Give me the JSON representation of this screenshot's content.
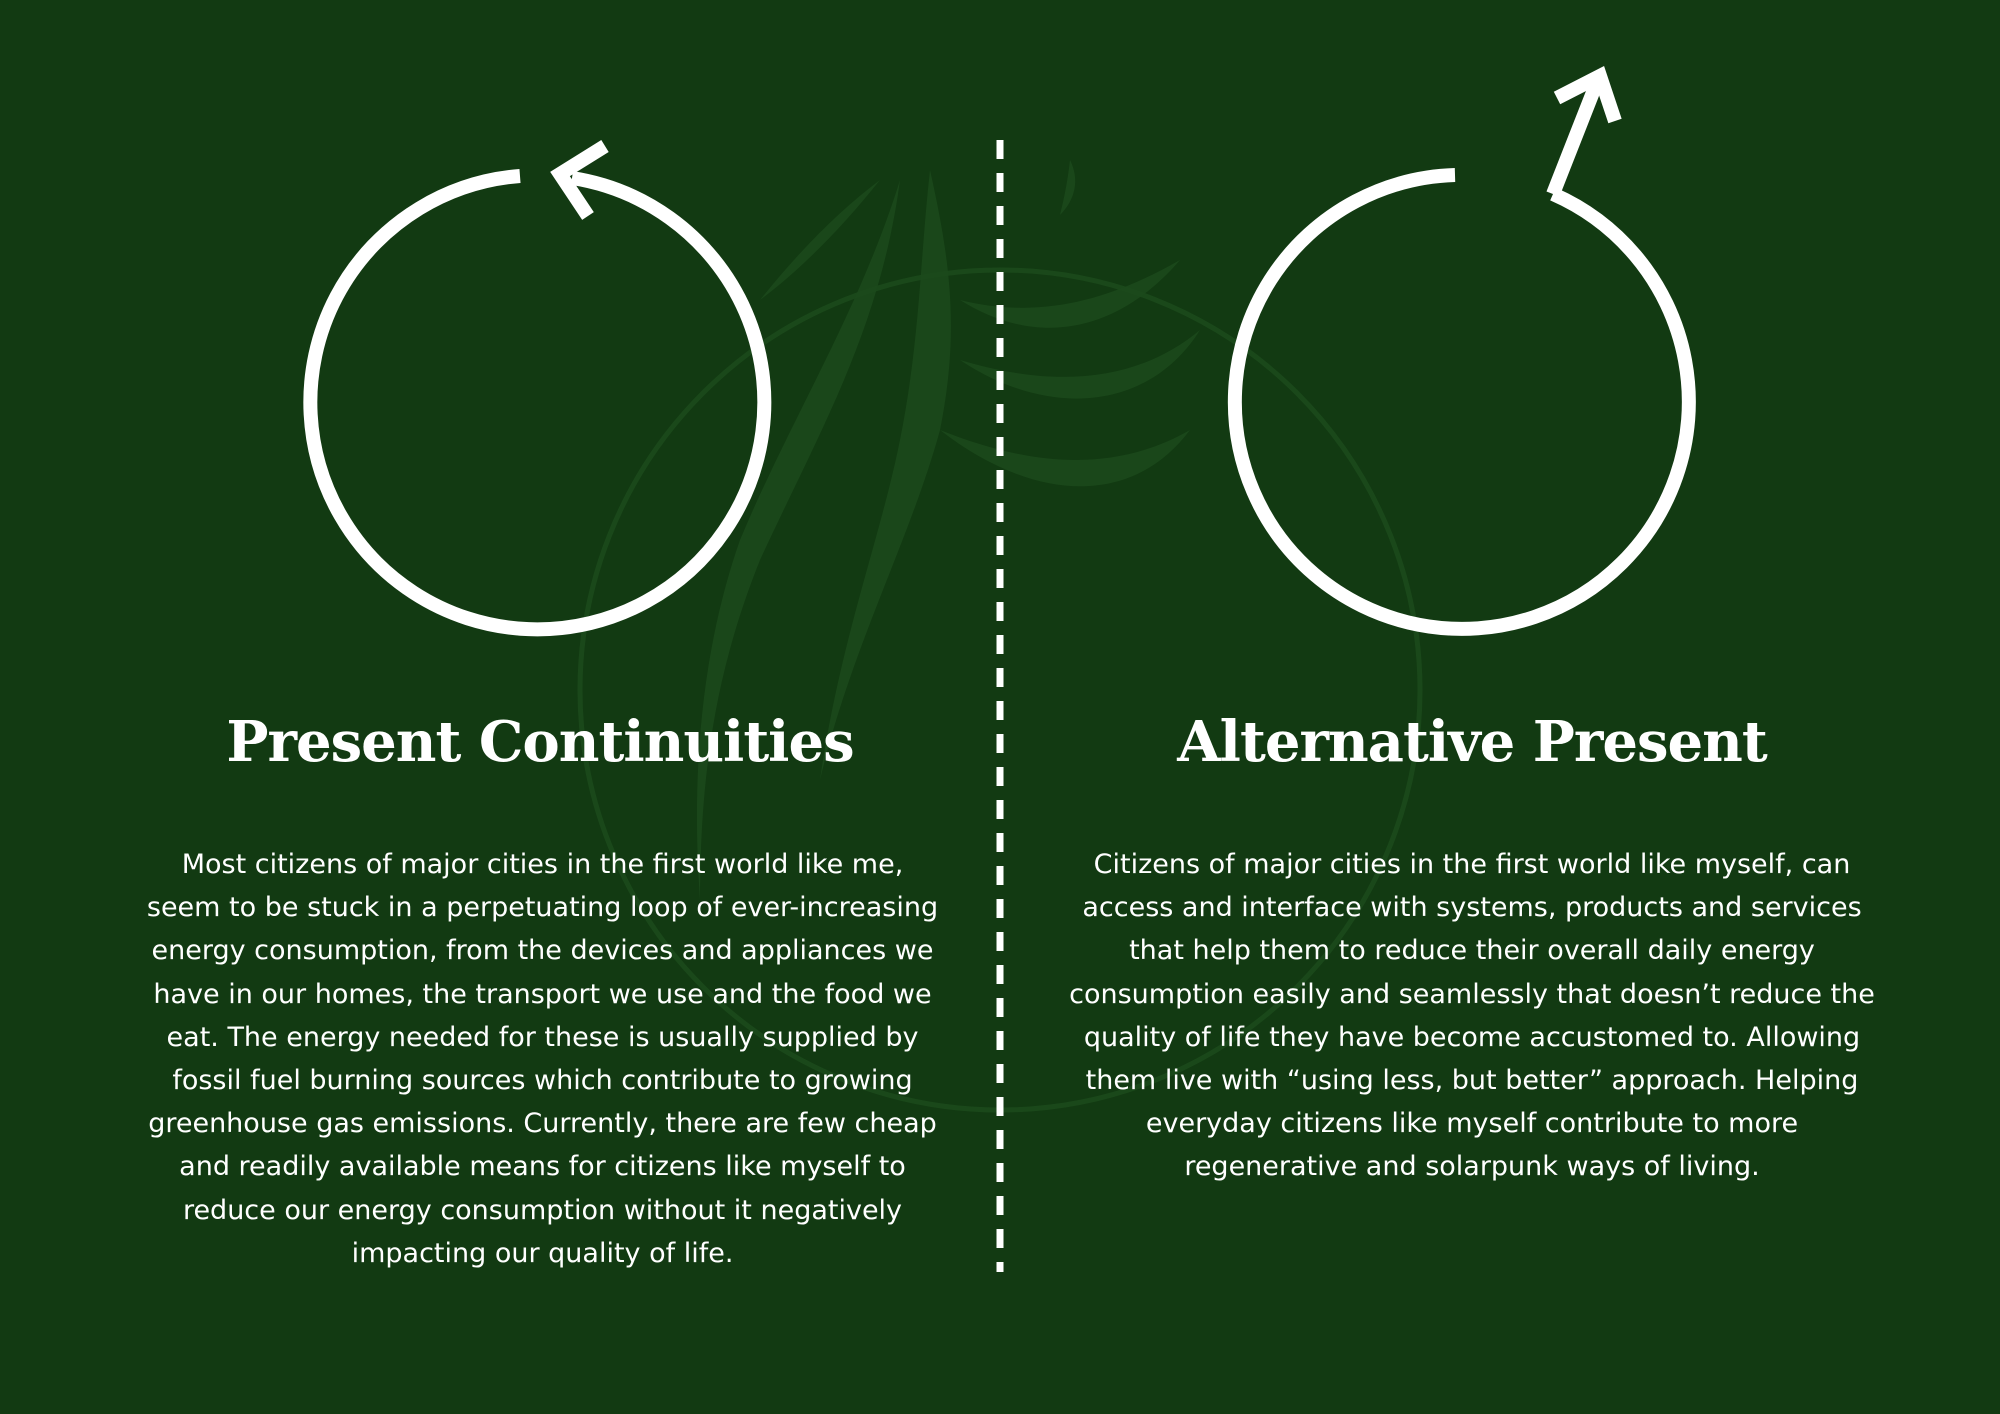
{
  "colors": {
    "background": "#123a12",
    "foreground": "#ffffff",
    "watermark": "#1c4a1c"
  },
  "icons": {
    "left": "circular-loop-arrow-icon",
    "right": "breakout-arrow-icon",
    "background": "leaf-wreath-watermark-icon"
  },
  "left_panel": {
    "title": "Present Continuities",
    "body": "Most citizens of major cities in the first world like me, seem to be stuck in a perpetuating loop of ever-increasing energy consumption, from the devices and appliances we have in our homes, the transport we use and the food we eat. The energy needed for these is usually supplied by fossil fuel burning sources which contribute to growing greenhouse gas emissions. Currently, there are few cheap and readily available means for citizens like myself to reduce our energy consumption without it negatively impacting our quality of life."
  },
  "right_panel": {
    "title": "Alternative Present",
    "body": "Citizens of major cities in the first world like myself, can access and interface with systems, products and services that help them to reduce their overall daily energy consumption easily and seamlessly that doesn’t reduce the quality of life they have become accustomed to. Allowing them live with “using less, but better” approach. Helping everyday citizens like myself contribute to more regenerative and solarpunk ways of living."
  }
}
